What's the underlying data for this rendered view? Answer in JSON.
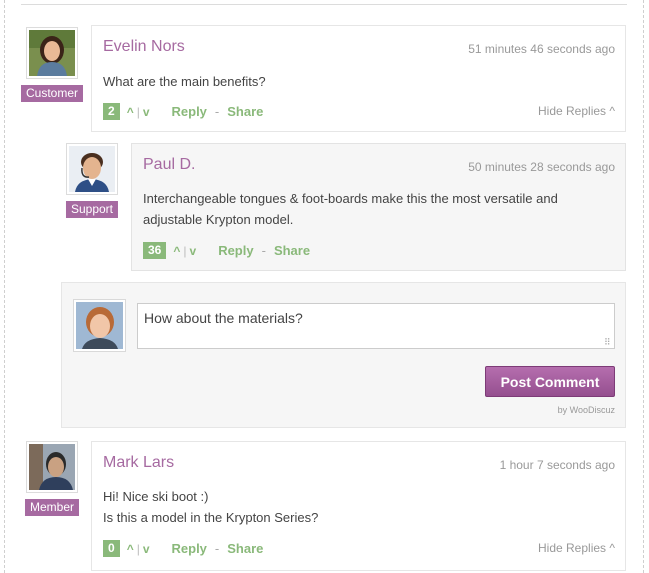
{
  "comments": [
    {
      "author": "Evelin Nors",
      "role": "Customer",
      "time": "51 minutes 46 seconds ago",
      "text": [
        "What are the main benefits?"
      ],
      "votes": "2",
      "vote_up": "^",
      "vote_sep": "|",
      "vote_down": "v",
      "reply": "Reply",
      "share": "Share",
      "separator": "-",
      "hide_replies": "Hide Replies ^"
    },
    {
      "author": "Paul D.",
      "role": "Support",
      "time": "50 minutes 28 seconds ago",
      "text": [
        "Interchangeable tongues & foot-boards make this the most versatile and",
        "adjustable Krypton model."
      ],
      "votes": "36",
      "vote_up": "^",
      "vote_sep": "|",
      "vote_down": "v",
      "reply": "Reply",
      "share": "Share",
      "separator": "-"
    },
    {
      "author": "Mark Lars",
      "role": "Member",
      "time": "1 hour 7 seconds ago",
      "text": [
        "Hi! Nice ski boot :)",
        "Is this a model in the Krypton Series?"
      ],
      "votes": "0",
      "vote_up": "^",
      "vote_sep": "|",
      "vote_down": "v",
      "reply": "Reply",
      "share": "Share",
      "separator": "-",
      "hide_replies": "Hide Replies ^"
    }
  ],
  "reply_form": {
    "value": "How about the materials?",
    "submit_label": "Post Comment",
    "powered_by": "by WooDiscuz"
  },
  "colors": {
    "accent_purple": "#a66aa1",
    "vote_green": "#8ab97a",
    "muted": "#999999"
  },
  "icons": [
    "avatar-evelin",
    "avatar-paul",
    "avatar-reply-user",
    "avatar-mark",
    "resize-grip-icon",
    "chevron-up-icon"
  ]
}
